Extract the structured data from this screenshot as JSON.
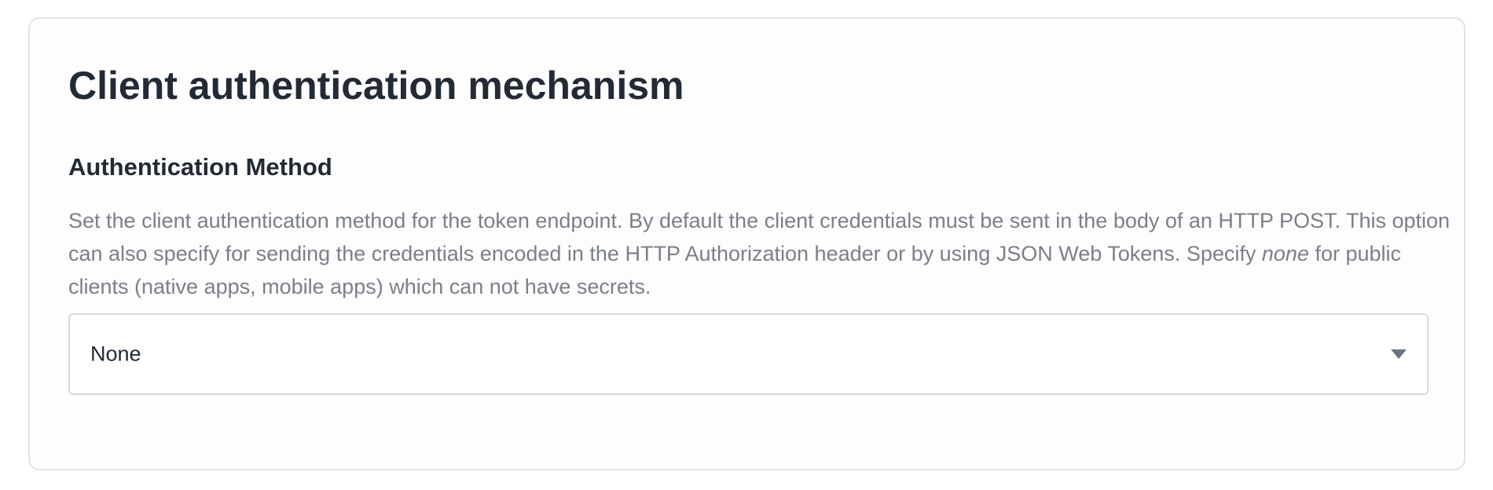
{
  "card": {
    "title": "Client authentication mechanism"
  },
  "field": {
    "label": "Authentication Method",
    "description_before": "Set the client authentication method for the token endpoint. By default the client credentials must be sent in the body of an HTTP POST. This option can also specify for sending the credentials encoded in the HTTP Authorization header or by using JSON Web Tokens. Specify ",
    "description_emphasis": "none",
    "description_after": " for public clients (native apps, mobile apps) which can not have secrets.",
    "select": {
      "value": "None",
      "icon": "chevron-down-icon"
    }
  },
  "colors": {
    "heading": "#222a35",
    "muted_text": "#7b7f86",
    "border": "#d5d8dd",
    "card_border": "#e2e4e8",
    "arrow": "#6b7280"
  }
}
